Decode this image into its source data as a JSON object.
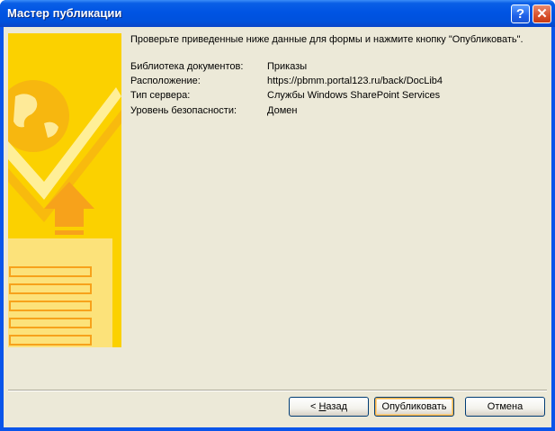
{
  "window": {
    "title": "Мастер публикации"
  },
  "titlebar": {
    "help_glyph": "?",
    "close_glyph": "✕"
  },
  "main": {
    "message": "Проверьте приведенные ниже данные для формы и нажмите кнопку \"Опубликовать\".",
    "info": [
      {
        "label": "Библиотека документов:",
        "value": "Приказы"
      },
      {
        "label": "Расположение:",
        "value": "https://pbmm.portal123.ru/back/DocLib4"
      },
      {
        "label": "Тип сервера:",
        "value": "Службы Windows SharePoint Services"
      },
      {
        "label": "Уровень безопасности:",
        "value": "Домен"
      }
    ]
  },
  "buttons": {
    "back_prefix": "< ",
    "back_mnemonic": "Н",
    "back_rest": "азад",
    "publish": "Опубликовать",
    "cancel": "Отмена"
  },
  "icons": {
    "banner": "publish-wizard-banner-icon",
    "help": "help-icon",
    "close": "close-icon"
  },
  "colors": {
    "titlebar": "#0054e3",
    "dialog_bg": "#ece9d8",
    "banner_yellow": "#f9c800",
    "banner_orange": "#f7a21b"
  }
}
